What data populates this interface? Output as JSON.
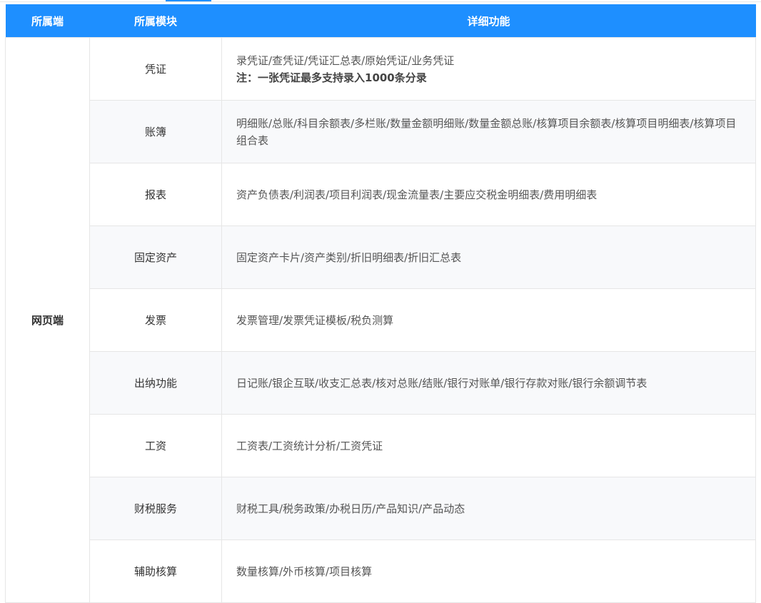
{
  "header": {
    "col_client": "所属端",
    "col_module": "所属模块",
    "col_detail": "详细功能"
  },
  "client": "网页端",
  "rows": [
    {
      "module": "凭证",
      "detail": "录凭证/查凭证/凭证汇总表/原始凭证/业务凭证",
      "note": "注：一张凭证最多支持录入1000条分录"
    },
    {
      "module": "账簿",
      "detail": "明细账/总账/科目余额表/多栏账/数量金额明细账/数量金额总账/核算项目余额表/核算项目明细表/核算项目组合表"
    },
    {
      "module": "报表",
      "detail": "资产负债表/利润表/项目利润表/现金流量表/主要应交税金明细表/费用明细表"
    },
    {
      "module": "固定资产",
      "detail": "固定资产卡片/资产类别/折旧明细表/折旧汇总表"
    },
    {
      "module": "发票",
      "detail": "发票管理/发票凭证模板/税负测算"
    },
    {
      "module": "出纳功能",
      "detail": "日记账/银企互联/收支汇总表/核对总账/结账/银行对账单/银行存款对账/银行余额调节表"
    },
    {
      "module": "工资",
      "detail": "工资表/工资统计分析/工资凭证"
    },
    {
      "module": "财税服务",
      "detail": "财税工具/税务政策/办税日历/产品知识/产品动态"
    },
    {
      "module": "辅助核算",
      "detail": "数量核算/外币核算/项目核算"
    }
  ]
}
